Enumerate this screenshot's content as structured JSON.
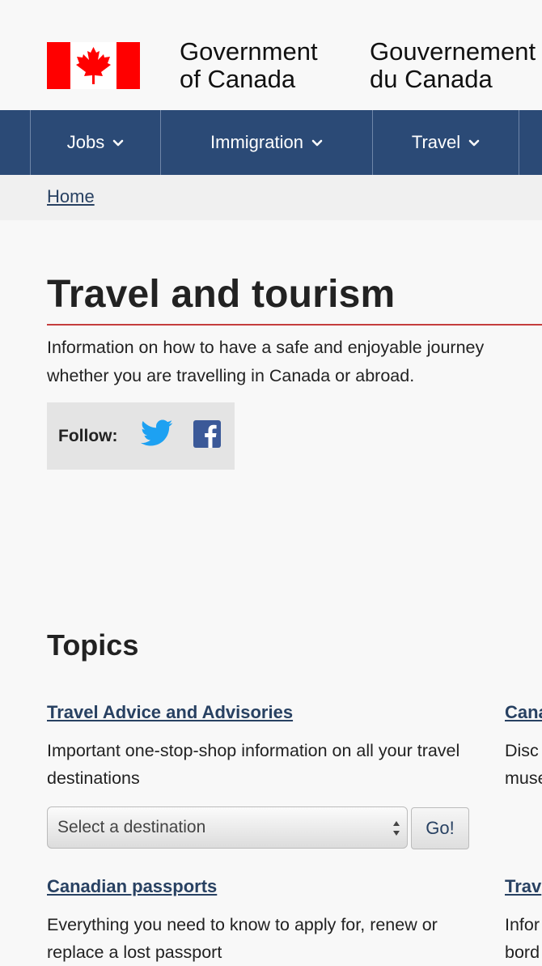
{
  "header": {
    "signature_en": "Government\nof Canada",
    "signature_fr": "Gouvernement\ndu Canada"
  },
  "menu": {
    "items": [
      {
        "label": "Jobs"
      },
      {
        "label": "Immigration"
      },
      {
        "label": "Travel"
      }
    ]
  },
  "breadcrumb": {
    "home": "Home"
  },
  "page": {
    "title": "Travel and tourism",
    "intro": "Information on how to have a safe and enjoyable journey whether you are travelling in Canada or abroad.",
    "follow_label": "Follow:"
  },
  "topics": {
    "heading": "Topics",
    "items": [
      {
        "title": "Travel Advice and Advisories",
        "desc": "Important one-stop-shop information on all your travel destinations"
      },
      {
        "title": "Canadian passports",
        "desc": "Everything you need to know to apply for, renew or replace a lost passport"
      }
    ],
    "right_items": [
      {
        "title": "Cana",
        "desc_line1": "Disc",
        "desc_line2": "muse"
      },
      {
        "title": "Trav",
        "desc_line1": "Infor",
        "desc_line2": "bord"
      }
    ],
    "destination_select": "Select a destination",
    "go_button": "Go!"
  },
  "colors": {
    "menu_bg": "#2b4a76",
    "link": "#284162",
    "title_rule": "#c53e3e",
    "flag_red": "#ff0000",
    "twitter": "#1da1f2",
    "facebook": "#3b5998"
  },
  "icons": {
    "menu_chevron": "chevron-down-icon",
    "twitter": "twitter-icon",
    "facebook": "facebook-icon",
    "select_arrows": "updown-arrows-icon"
  }
}
